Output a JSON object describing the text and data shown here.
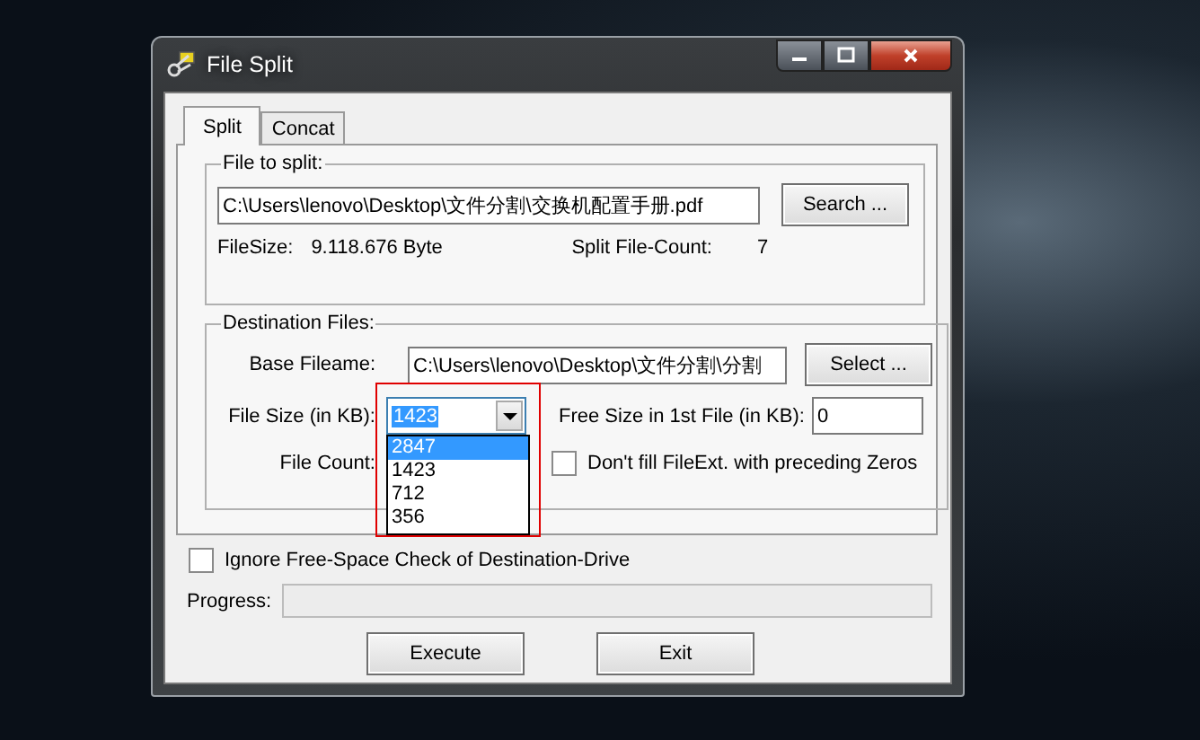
{
  "window": {
    "title": "File Split"
  },
  "tabs": [
    {
      "label": "Split",
      "selected": true
    },
    {
      "label": "Concat",
      "selected": false
    }
  ],
  "source_group": {
    "title": "File to split:",
    "path": "C:\\Users\\lenovo\\Desktop\\文件分割\\交换机配置手册.pdf",
    "search_button": "Search ...",
    "file_size_label": "FileSize:",
    "file_size_value": "9.118.676 Byte",
    "count_label": "Split File-Count:",
    "count_value": "7"
  },
  "destination_group": {
    "title": "Destination Files:",
    "base_label": "Base Fileame:",
    "base_value": "C:\\Users\\lenovo\\Desktop\\文件分割\\分割",
    "select_button": "Select ...",
    "size_label": "File Size (in KB):",
    "size_value": "1423",
    "size_dropdown": {
      "expanded": true,
      "highlighted": true,
      "options": [
        {
          "label": "2847",
          "selected": true
        },
        {
          "label": "1423",
          "selected": false
        },
        {
          "label": "712",
          "selected": false
        },
        {
          "label": "356",
          "selected": false
        }
      ]
    },
    "free_label": "Free Size in 1st File (in KB):",
    "free_value": "0",
    "count_label": "File Count:",
    "no_zero_fill": {
      "label": "Don't fill FileExt. with preceding Zeros",
      "checked": false
    }
  },
  "ignore_free_space": {
    "label": "Ignore Free-Space Check of Destination-Drive",
    "checked": false
  },
  "progress": {
    "label": "Progress:",
    "level": 0
  },
  "buttons": [
    {
      "label": "Execute"
    },
    {
      "label": "Exit"
    }
  ]
}
